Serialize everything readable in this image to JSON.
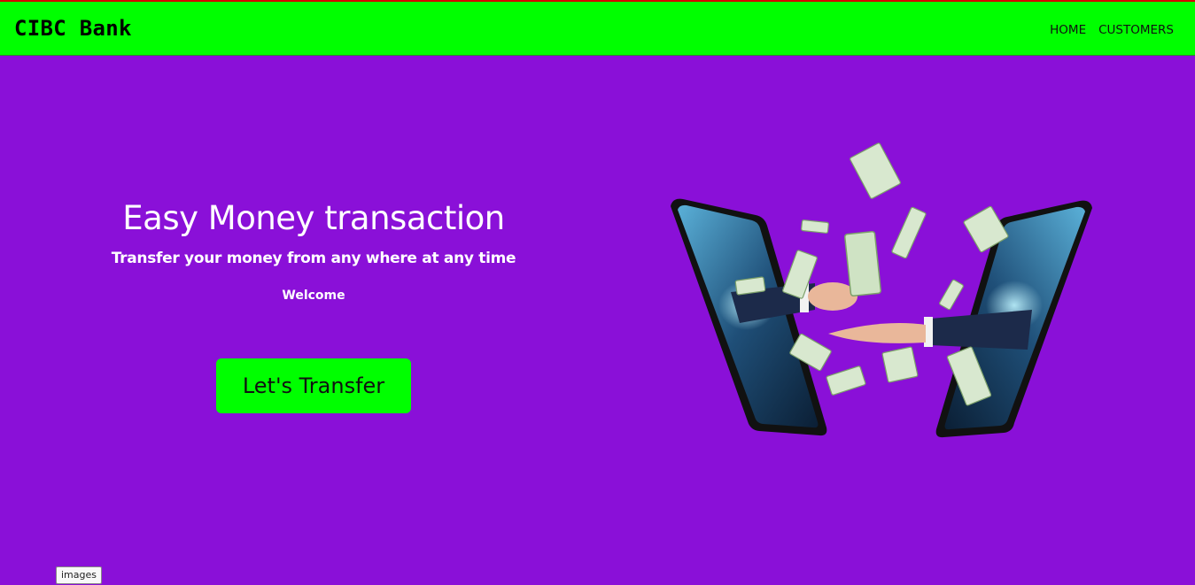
{
  "navbar": {
    "brand": "CIBC Bank",
    "links": [
      {
        "label": "HOME"
      },
      {
        "label": "CUSTOMERS"
      }
    ]
  },
  "hero": {
    "title": "Easy Money transaction",
    "subtitle": "Transfer your money from any where at any time",
    "welcome": "Welcome",
    "cta_label": "Let's Transfer"
  },
  "illustration": {
    "icon": "phones-money-transfer-icon"
  },
  "tooltip": {
    "text": "images"
  },
  "colors": {
    "background": "#8a10d8",
    "navbar": "#00ff00",
    "button": "#00ff00",
    "text": "#ffffff"
  }
}
